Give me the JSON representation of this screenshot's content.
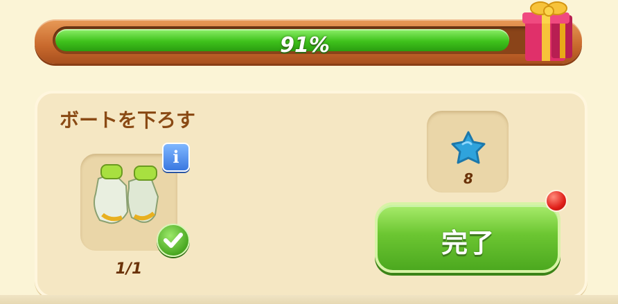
{
  "progress": {
    "percent": 91,
    "label": "91%"
  },
  "quest": {
    "title": "ボートを下ろす",
    "item": {
      "icon": "gloves-icon",
      "count_label": "1/1",
      "completed": true
    },
    "reward": {
      "icon": "star-icon",
      "amount": "8"
    },
    "complete_button_label": "完了"
  },
  "colors": {
    "progress_fill": "#3fc21c",
    "frame": "#c8692d",
    "button": "#6cc632",
    "notify": "#e0201a"
  }
}
